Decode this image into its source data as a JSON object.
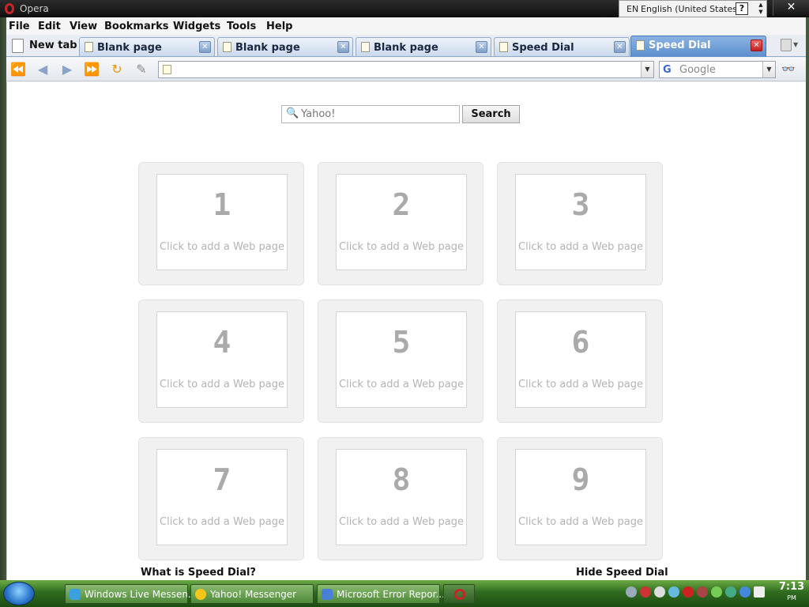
{
  "window": {
    "title": "Opera"
  },
  "langbar": {
    "code": "EN",
    "name": "English (United States)",
    "help": "?"
  },
  "menu": [
    "File",
    "Edit",
    "View",
    "Bookmarks",
    "Widgets",
    "Tools",
    "Help"
  ],
  "tabs": {
    "new_tab": "New tab",
    "items": [
      {
        "label": "Blank page",
        "active": false
      },
      {
        "label": "Blank page",
        "active": false
      },
      {
        "label": "Blank page",
        "active": false
      },
      {
        "label": "Speed Dial",
        "active": false
      },
      {
        "label": "Speed Dial",
        "active": true
      }
    ]
  },
  "toolbar": {
    "address_value": "",
    "search_engine": "Google",
    "google_icon": "G"
  },
  "speed_dial": {
    "search_placeholder": "Yahoo!",
    "search_button": "Search",
    "dials": [
      {
        "number": "1",
        "text": "Click to add a Web page"
      },
      {
        "number": "2",
        "text": "Click to add a Web page"
      },
      {
        "number": "3",
        "text": "Click to add a Web page"
      },
      {
        "number": "4",
        "text": "Click to add a Web page"
      },
      {
        "number": "5",
        "text": "Click to add a Web page"
      },
      {
        "number": "6",
        "text": "Click to add a Web page"
      },
      {
        "number": "7",
        "text": "Click to add a Web page"
      },
      {
        "number": "8",
        "text": "Click to add a Web page"
      },
      {
        "number": "9",
        "text": "Click to add a Web page"
      }
    ],
    "what_is": "What is Speed Dial?",
    "hide": "Hide Speed Dial"
  },
  "taskbar": {
    "tasks": [
      {
        "label": "Windows Live Messen...",
        "icon_color": "#3aa0e0"
      },
      {
        "label": "Yahoo! Messenger",
        "icon_color": "#f5c518"
      },
      {
        "label": "Microsoft Error Repor...",
        "icon_color": "#4a7fd6"
      },
      {
        "label": "",
        "icon_color": "#c7252a"
      }
    ],
    "clock": "7:13",
    "clock_suffix": "PM"
  },
  "colors": {
    "opera_red": "#c7252a",
    "tab_active": "#5c8fcd",
    "taskbar_green": "#2f6b1f"
  }
}
